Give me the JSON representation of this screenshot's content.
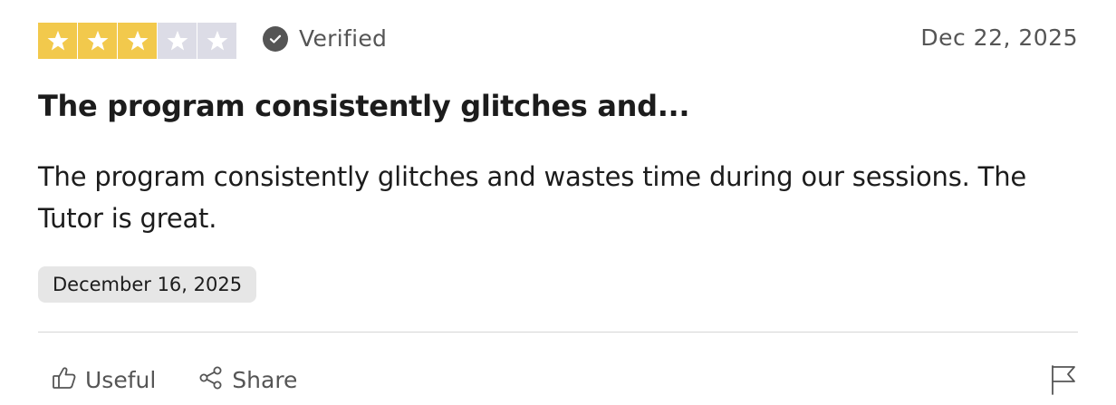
{
  "review": {
    "rating": 3,
    "rating_max": 5,
    "star_filled_color": "#f2c94c",
    "star_empty_color": "#dcdce6",
    "verified_label": "Verified",
    "published_date": "Dec 22, 2025",
    "title": "The program consistently glitches and...",
    "body": "The program consistently glitches and wastes time during our sessions. The Tutor is great.",
    "experience_date": "December 16, 2025"
  },
  "actions": {
    "useful_label": "Useful",
    "share_label": "Share",
    "useful_icon": "thumbs-up-icon",
    "share_icon": "share-icon",
    "report_icon": "flag-icon"
  }
}
